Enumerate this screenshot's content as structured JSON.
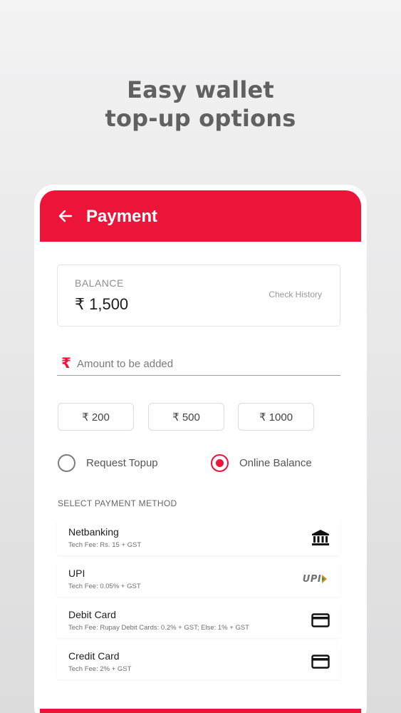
{
  "promo": {
    "line1": "Easy wallet",
    "line2": "top-up options"
  },
  "appbar": {
    "title": "Payment",
    "back_icon": "arrow-left-icon"
  },
  "balance": {
    "label": "BALANCE",
    "value": "₹ 1,500",
    "check_history": "Check History"
  },
  "amount": {
    "currency_symbol": "₹",
    "placeholder": "Amount to be added"
  },
  "quick_amounts": [
    "₹ 200",
    "₹ 500",
    "₹ 1000"
  ],
  "topup_type": {
    "options": [
      {
        "label": "Request Topup",
        "selected": false
      },
      {
        "label": "Online Balance",
        "selected": true
      }
    ]
  },
  "payment_methods": {
    "title": "SELECT PAYMENT METHOD",
    "items": [
      {
        "name": "Netbanking",
        "fee": "Tech Fee: Rs. 15 + GST",
        "icon": "bank-icon"
      },
      {
        "name": "UPI",
        "fee": "Tech Fee: 0.05% + GST",
        "icon": "upi-logo-icon",
        "icon_text": "UPI"
      },
      {
        "name": "Debit Card",
        "fee": "Tech Fee: Rupay Debit Cards: 0.2% + GST; Else: 1% + GST",
        "icon": "card-icon"
      },
      {
        "name": "Credit Card",
        "fee": "Tech Fee: 2% + GST",
        "icon": "card-icon"
      }
    ]
  },
  "colors": {
    "brand": "#ec1439",
    "headline": "#616161"
  }
}
